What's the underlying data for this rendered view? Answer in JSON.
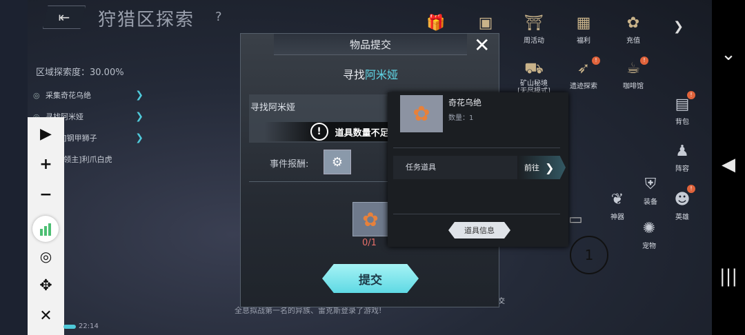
{
  "header": {
    "back_icon": "exit-icon",
    "title": "狩猎区探索",
    "help": "?"
  },
  "explore": {
    "label": "区域探索度：30.00%"
  },
  "tasks": [
    {
      "label": "采集奇花乌绝"
    },
    {
      "label": "寻找阿米娅"
    },
    {
      "label": "[领主]钢甲狮子"
    },
    {
      "label": "击败[领主]利爪白虎"
    }
  ],
  "top_icons": [
    {
      "label": ""
    },
    {
      "label": ""
    },
    {
      "label": "周活动"
    },
    {
      "label": "福利"
    },
    {
      "label": "充值"
    }
  ],
  "mid_icons": [
    {
      "label": "矿山秘境\n[无尽模式]"
    },
    {
      "label": "遗迹探索"
    },
    {
      "label": "咖啡馆"
    }
  ],
  "side_icons": [
    {
      "label": "背包"
    },
    {
      "label": "阵容"
    },
    {
      "label": "装备"
    },
    {
      "label": "神器"
    },
    {
      "label": "英雄"
    },
    {
      "label": "宠物"
    }
  ],
  "bottom": {
    "social": "社交",
    "time": "22:14",
    "ticker": "全息拟战第一名的异族、雷克斯登录了游戏!"
  },
  "crosshair": "1",
  "dialog": {
    "title": "物品提交",
    "subtitle_prefix": "寻找",
    "subtitle_highlight": "阿米娅",
    "find_label_prefix": "寻找",
    "find_label_highlight": "阿米娅",
    "warning": "道具数量不足,无法提交!",
    "reward_label": "事件报酬:",
    "item_count": "0/1",
    "submit": "提交"
  },
  "tooltip": {
    "name": "奇花乌绝",
    "qty": "数量：1",
    "task_item": "任务道具",
    "goto": "前往",
    "info": "道具信息"
  },
  "colors": {
    "accent": "#5fd6e6",
    "warning_red": "#e8706a",
    "badge": "#e0633b"
  }
}
